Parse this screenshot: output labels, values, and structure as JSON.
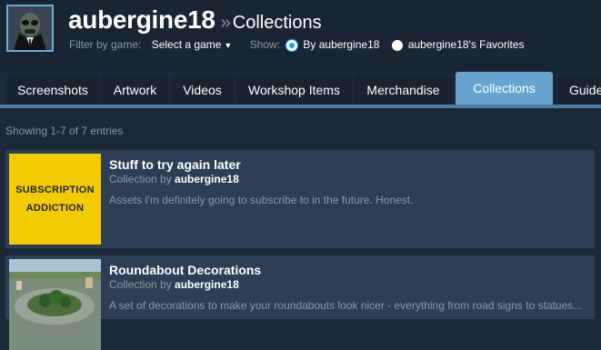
{
  "header": {
    "username": "aubergine18",
    "separator": "»",
    "section": "Collections",
    "filter_label": "Filter by game:",
    "filter_value": "Select a game",
    "show_label": "Show:",
    "show_options": [
      {
        "label": "By aubergine18",
        "selected": true
      },
      {
        "label": "aubergine18's Favorites",
        "selected": false
      }
    ]
  },
  "tabs": [
    {
      "label": "Screenshots"
    },
    {
      "label": "Artwork"
    },
    {
      "label": "Videos"
    },
    {
      "label": "Workshop Items"
    },
    {
      "label": "Merchandise"
    },
    {
      "label": "Collections",
      "active": true
    },
    {
      "label": "Guide"
    }
  ],
  "listing": {
    "count_text": "Showing 1-7 of 7 entries"
  },
  "items": [
    {
      "thumb_line1": "SUBSCRIPTION",
      "thumb_line2": "ADDICTION",
      "title": "Stuff to try again later",
      "by_text": "Collection by",
      "author": "aubergine18",
      "description": "Assets I'm definitely going to subscribe to in the future. Honest."
    },
    {
      "title": "Roundabout Decorations",
      "by_text": "Collection by",
      "author": "aubergine18",
      "description": "A set of decorations to make your roundabouts look nicer - everything from road signs to statues..."
    }
  ],
  "colors": {
    "background": "#1b2838",
    "accent_tab": "#67a3cf",
    "item_bg": "#2e3f55",
    "thumb_yellow": "#f2cc00",
    "radio_selected": "#1a9fff"
  }
}
